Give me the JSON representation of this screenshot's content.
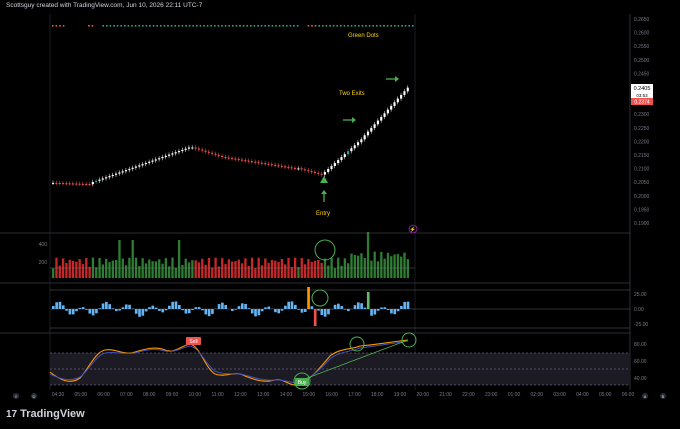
{
  "header": {
    "caption": "Scottsguy created with TradingView.com, Jun 10, 2026 22:11 UTC-7"
  },
  "annotations": {
    "green_dots": "Green Dots",
    "two_exits": "Two Exits",
    "entry": "Entry",
    "sell_tag": "Sell",
    "buy_tag": "Buy"
  },
  "price_axis": {
    "ticks": [
      "0.2650",
      "0.2600",
      "0.2550",
      "0.2500",
      "0.2450",
      "0.2400",
      "0.2350",
      "0.2300",
      "0.2250",
      "0.2200",
      "0.2150",
      "0.2100",
      "0.2050",
      "0.2000",
      "0.1950",
      "0.1900"
    ],
    "last_price": "0.2405",
    "countdown": "03:53",
    "prev_price": "0.2374"
  },
  "volume_axis": {
    "ticks": [
      "400",
      "200"
    ]
  },
  "oscillator_axis": {
    "ticks": [
      "25.00",
      "0.00",
      "-25.00"
    ]
  },
  "rsi_axis": {
    "ticks": [
      "80.00",
      "60.00",
      "40.00"
    ]
  },
  "time_axis": {
    "ticks": [
      "04:30",
      "05:00",
      "06:00",
      "07:00",
      "08:00",
      "09:00",
      "10:00",
      "11:00",
      "12:00",
      "13:00",
      "14:00",
      "15:00",
      "16:00",
      "17:00",
      "18:00",
      "19:00",
      "20:00",
      "21:00",
      "22:00",
      "23:00",
      "01:00",
      "02:00",
      "03:00",
      "04:00",
      "05:00",
      "06:00"
    ]
  },
  "controls": {
    "goto_left": "Y",
    "settings": "D",
    "scale_toggle": "A",
    "bottom_right": "B"
  },
  "brand": {
    "name": "TradingView",
    "logo": "17"
  },
  "colors": {
    "up": "#ffffff",
    "down": "#ef5350",
    "signal_up": "#26a69a",
    "vol_up": "#2e7d32",
    "vol_down": "#c62828",
    "osc": "#64b5f6",
    "annotation": "#ffd600",
    "arrow": "#4caf50"
  }
}
